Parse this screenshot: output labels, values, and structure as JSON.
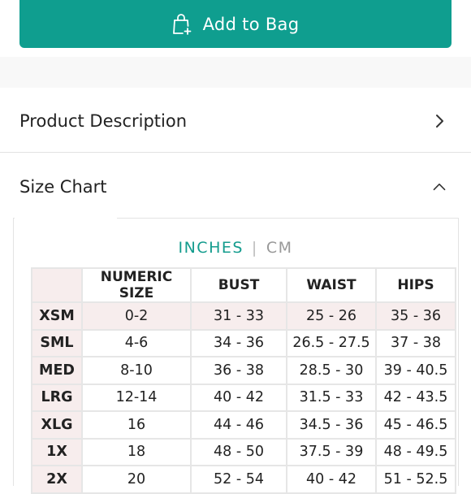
{
  "add_to_bag": {
    "label": "Add to Bag",
    "color": "#0f9e8f"
  },
  "accordion": {
    "product_description": {
      "title": "Product Description",
      "icon": "chevron-right-icon"
    },
    "size_chart": {
      "title": "Size Chart",
      "icon": "chevron-up-icon"
    }
  },
  "units": {
    "active": "INCHES",
    "separator": "|",
    "inactive": "CM"
  },
  "size_table": {
    "headers": [
      "NUMERIC SIZE",
      "BUST",
      "WAIST",
      "HIPS"
    ],
    "rows": [
      {
        "label": "XSM",
        "cells": [
          "0-2",
          "31 - 33",
          "25 - 26",
          "35 - 36"
        ]
      },
      {
        "label": "SML",
        "cells": [
          "4-6",
          "34 - 36",
          "26.5 - 27.5",
          "37 - 38"
        ]
      },
      {
        "label": "MED",
        "cells": [
          "8-10",
          "36 - 38",
          "28.5 - 30",
          "39 - 40.5"
        ]
      },
      {
        "label": "LRG",
        "cells": [
          "12-14",
          "40 - 42",
          "31.5 - 33",
          "42 - 43.5"
        ]
      },
      {
        "label": "XLG",
        "cells": [
          "16",
          "44 - 46",
          "34.5 - 36",
          "45 - 46.5"
        ]
      },
      {
        "label": "1X",
        "cells": [
          "18",
          "48 - 50",
          "37.5 - 39",
          "48 - 49.5"
        ]
      },
      {
        "label": "2X",
        "cells": [
          "20",
          "52 - 54",
          "40 - 42",
          "51 - 52.5"
        ]
      }
    ]
  }
}
